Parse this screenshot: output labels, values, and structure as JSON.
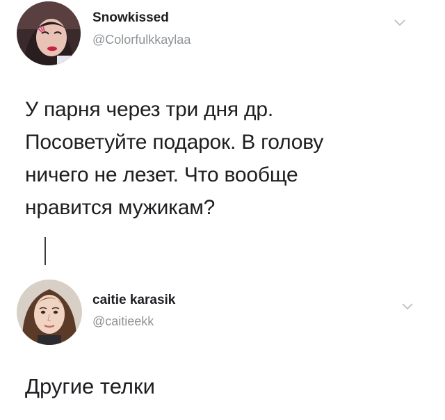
{
  "tweets": [
    {
      "display_name": "Snowkissed",
      "handle": "@Colorfulkkaylaa",
      "text_lines": [
        "У парня через три дня др.",
        "Посоветуйте подарок. В голову",
        "ничего не лезет. Что вообще",
        "нравится мужикам?"
      ],
      "avatar_icon": "profile-photo",
      "menu_icon": "chevron-down-icon"
    },
    {
      "display_name": "caitie karasik",
      "handle": "@caitieekk",
      "text": "Другие телки",
      "avatar_icon": "profile-photo",
      "menu_icon": "chevron-down-icon"
    }
  ],
  "colors": {
    "background": "#ffffff",
    "text": "#1c1e21",
    "handle": "#8e9296",
    "chevron": "#b6babe",
    "thread_line": "#3a3d40"
  }
}
